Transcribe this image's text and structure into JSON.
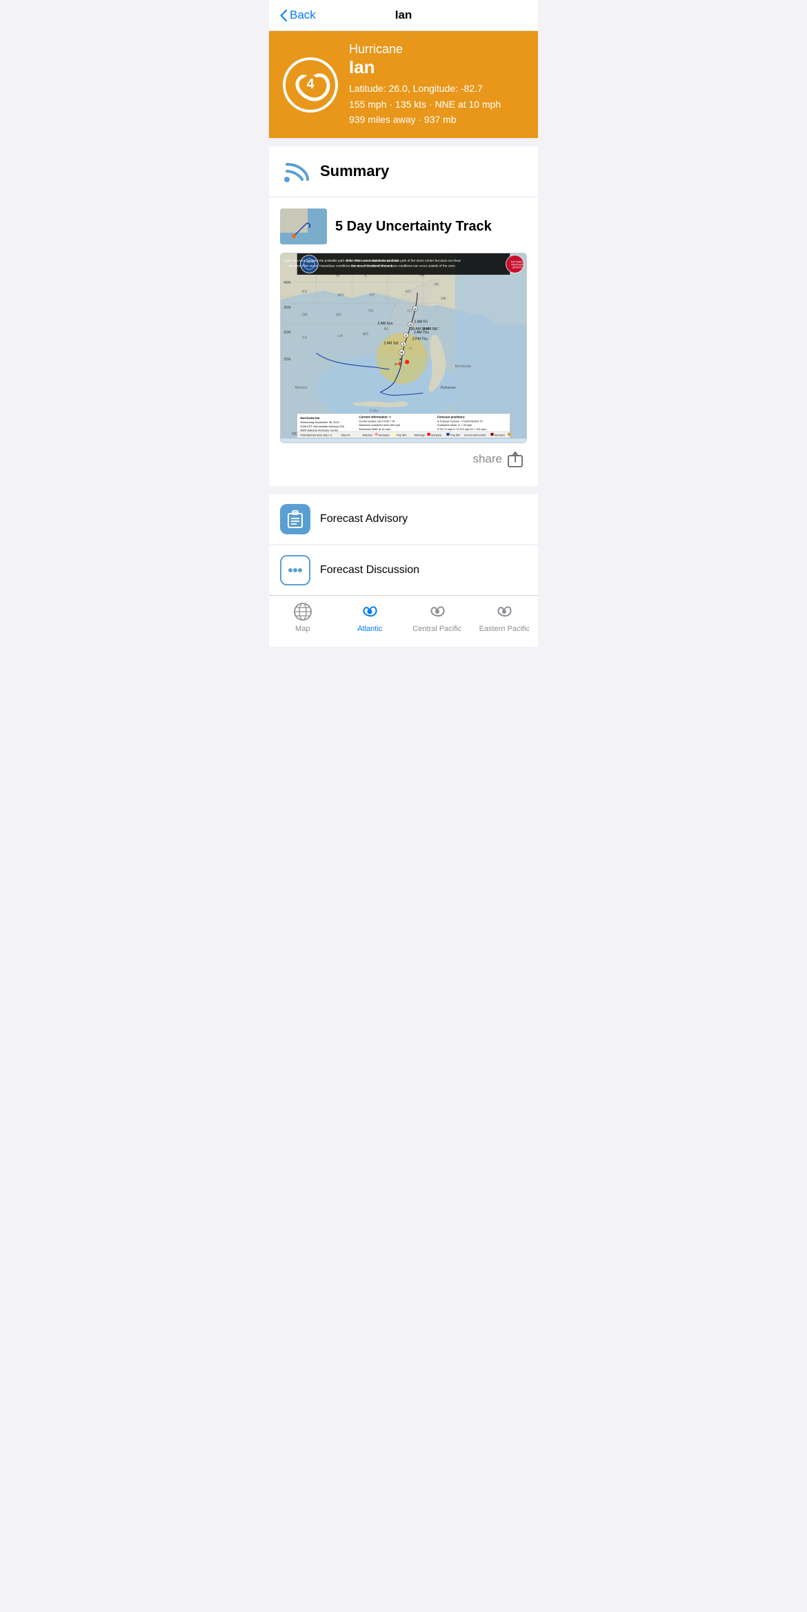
{
  "nav": {
    "back_label": "Back",
    "title": "Ian"
  },
  "hurricane": {
    "type": "Hurricane",
    "name": "Ian",
    "category": "4",
    "latitude": "26.0",
    "longitude": "-82.7",
    "coords_label": "Latitude: 26.0, Longitude: -82.7",
    "wind_speed": "155 mph · 135 kts · NNE at 10 mph",
    "distance": "939 miles away · 937 mb"
  },
  "sections": {
    "summary_label": "Summary",
    "track_title": "5 Day Uncertainty Track",
    "forecast_advisory_label": "Forecast Advisory",
    "forecast_discussion_label": "Forecast Discussion"
  },
  "share_label": "share",
  "tabs": [
    {
      "id": "map",
      "label": "Map",
      "active": false
    },
    {
      "id": "atlantic",
      "label": "Atlantic",
      "active": true
    },
    {
      "id": "central-pacific",
      "label": "Central Pacific",
      "active": false
    },
    {
      "id": "eastern-pacific",
      "label": "Eastern Pacific",
      "active": false
    }
  ]
}
